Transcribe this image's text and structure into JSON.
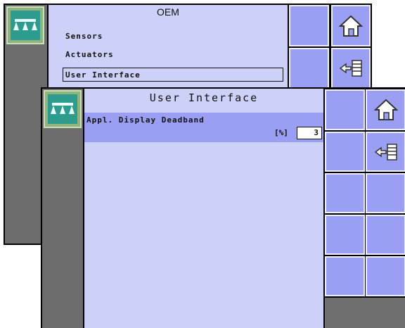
{
  "back_screen": {
    "title": "OEM",
    "menu": [
      {
        "label": "Sensors"
      },
      {
        "label": "Actuators"
      },
      {
        "label": "User Interface",
        "selected": true
      }
    ]
  },
  "front_screen": {
    "title": "User Interface",
    "setting": {
      "label": "Appl. Display Deadband",
      "unit": "[%]",
      "value": "3"
    }
  },
  "icons": {
    "app": "boom-spray-icon",
    "home": "home-icon",
    "back": "back-menu-icon"
  },
  "colors": {
    "panel": "#cdd0f7",
    "button": "#9a9ff4",
    "sidebar": "#6d6d6d",
    "app_icon": "#2e9b8f"
  }
}
